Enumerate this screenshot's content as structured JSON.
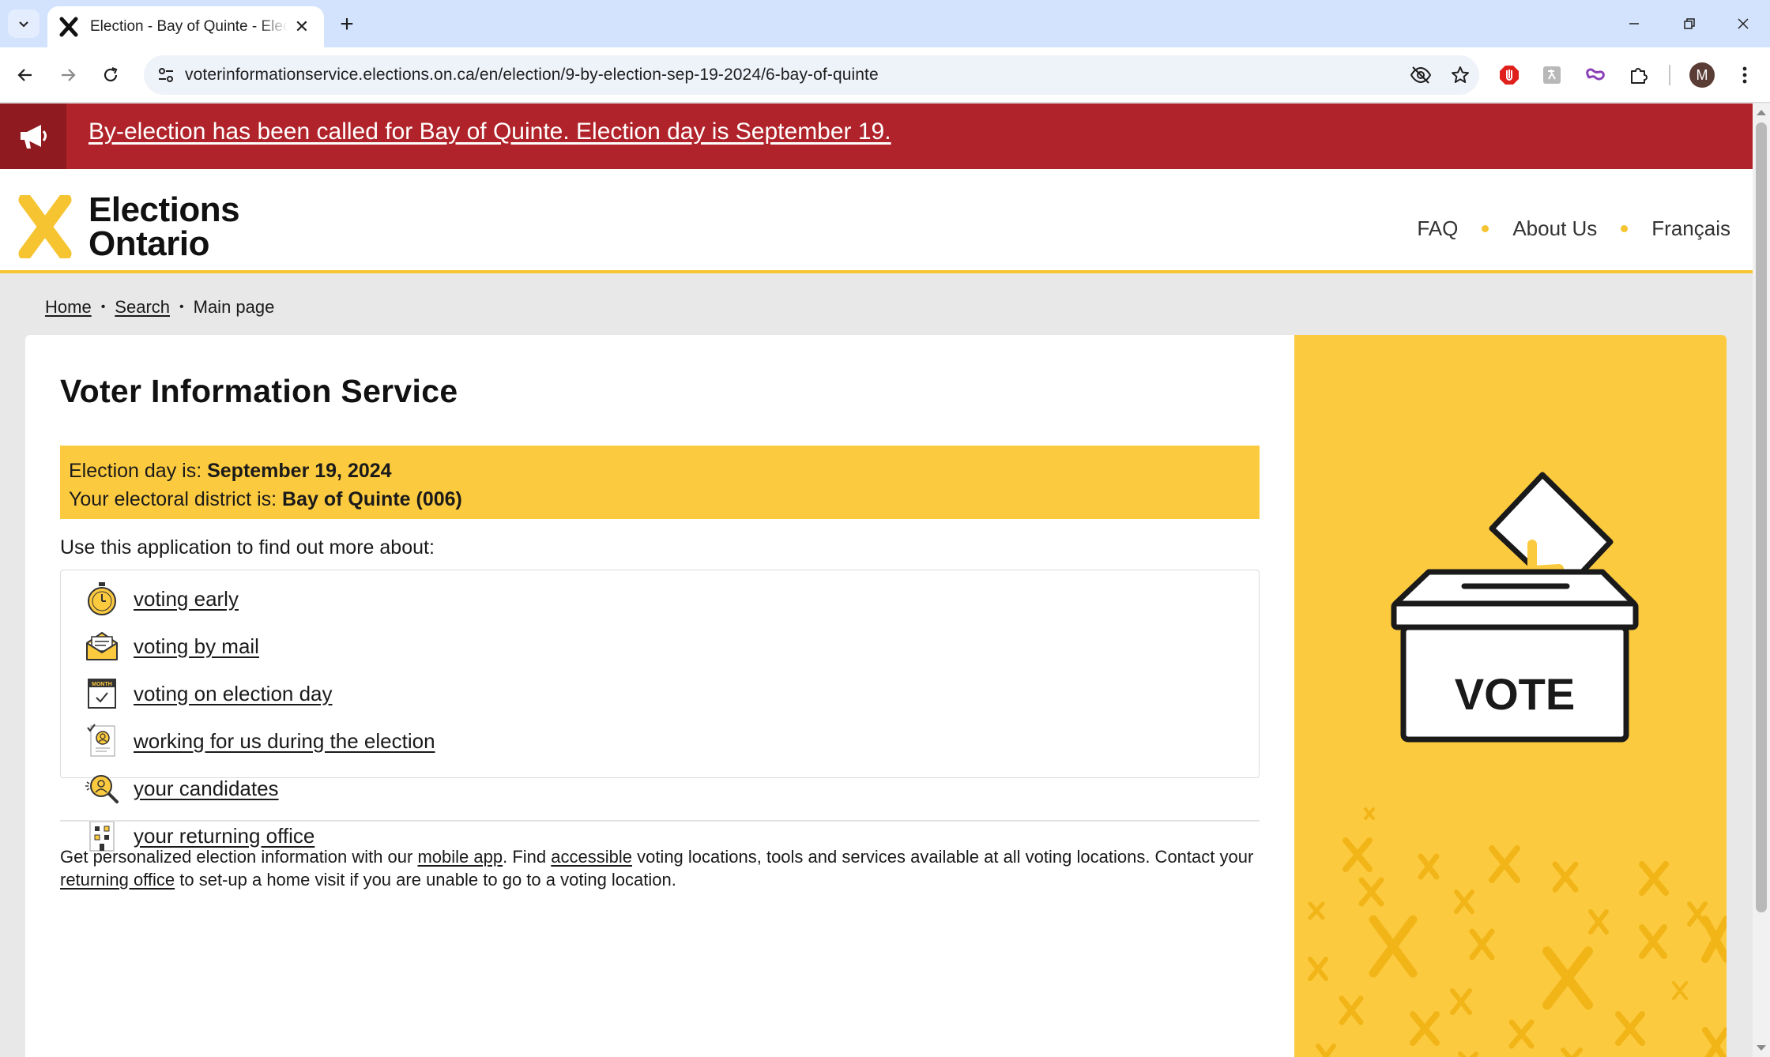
{
  "browser": {
    "tab_title": "Election - Bay of Quinte - Elections Ontario",
    "tab_close": "✕",
    "new_tab": "+",
    "url": "voterinformationservice.elections.on.ca/en/election/9-by-election-sep-19-2024/6-bay-of-quinte",
    "profile_initial": "M"
  },
  "alert": {
    "text": "By-election has been called for Bay of Quinte. Election day is September 19."
  },
  "header": {
    "logo_line1": "Elections",
    "logo_line2": "Ontario",
    "nav": [
      "FAQ",
      "About Us",
      "Français"
    ]
  },
  "breadcrumb": {
    "home": "Home",
    "search": "Search",
    "current": "Main page",
    "separator": "•"
  },
  "main": {
    "title": "Voter Information Service",
    "election_day_label": "Election day is: ",
    "election_day_value": "September 19, 2024",
    "district_label": "Your electoral district is: ",
    "district_value": "Bay of Quinte (006)",
    "intro": "Use this application to find out more about:",
    "links": [
      {
        "label": "voting early",
        "icon": "stopwatch-icon"
      },
      {
        "label": "voting by mail",
        "icon": "envelope-icon"
      },
      {
        "label": "voting on election day",
        "icon": "calendar-icon"
      },
      {
        "label": "working for us during the election",
        "icon": "worker-badge-icon"
      },
      {
        "label": "your candidates",
        "icon": "magnifier-person-icon"
      },
      {
        "label": "your returning office",
        "icon": "building-icon"
      }
    ],
    "calendar_icon_text": "MONTH",
    "footnote": {
      "t1": "Get personalized election information with our ",
      "l1": "mobile app",
      "t2": ". Find ",
      "l2": "accessible",
      "t3": " voting locations, tools and services available at all voting locations. Contact your ",
      "l3": "returning office",
      "t4": " to set-up a home visit if you are unable to go to a voting location."
    }
  },
  "side_panel": {
    "ballot_box_text": "VOTE"
  },
  "colors": {
    "alert_red": "#b1232a",
    "brand_yellow": "#fcca3f",
    "logo_yellow": "#f5c430"
  }
}
